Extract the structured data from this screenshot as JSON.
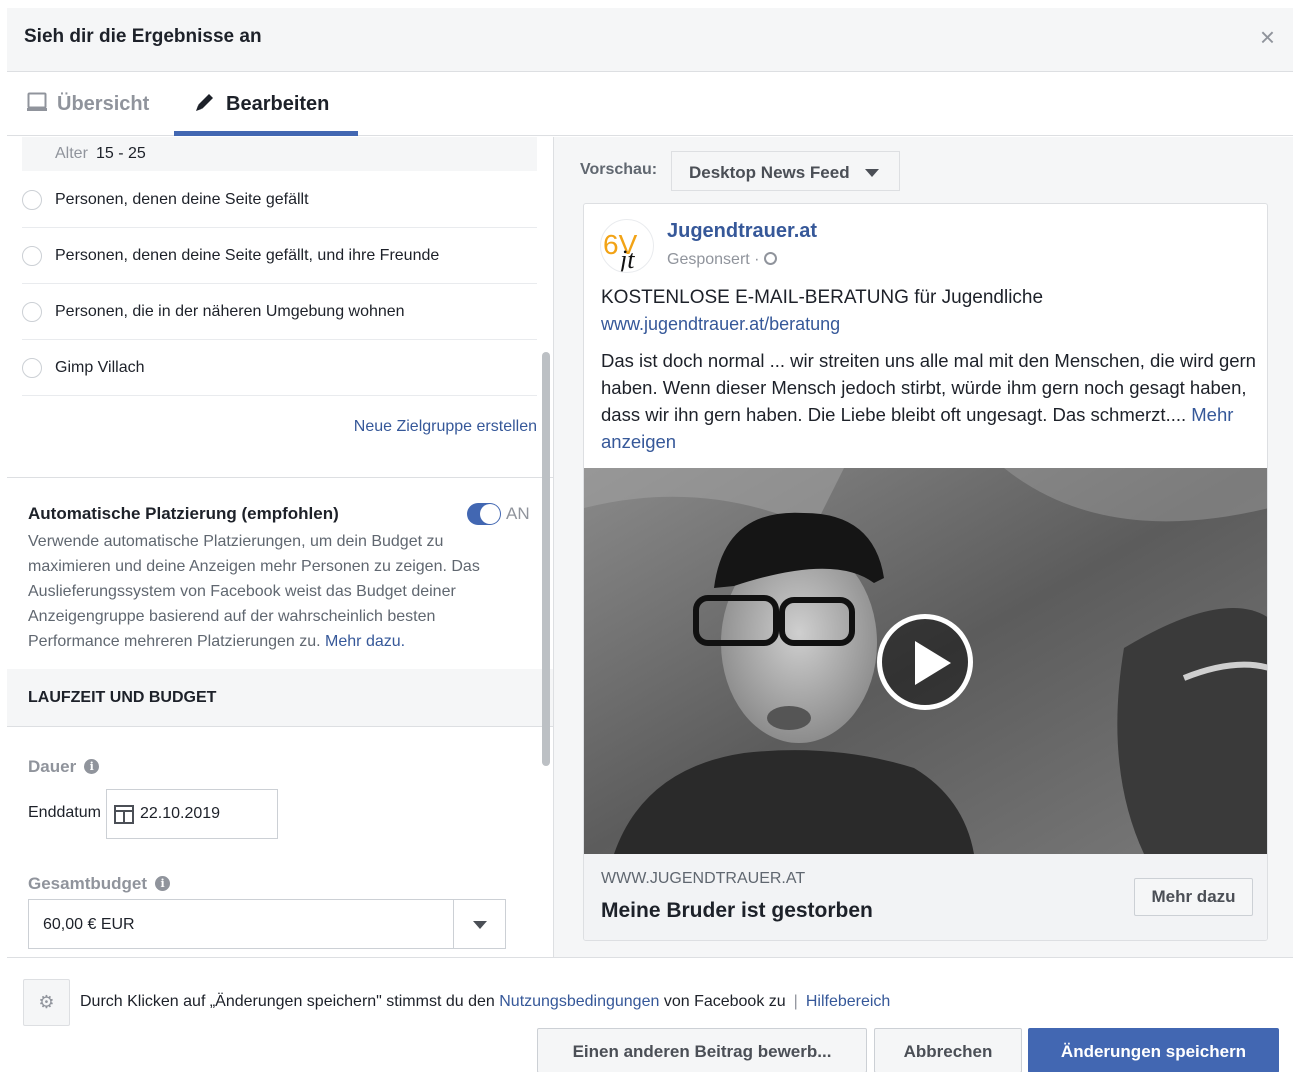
{
  "dialog": {
    "title": "Sieh dir die Ergebnisse an",
    "close": "×"
  },
  "tabs": [
    {
      "label": "Übersicht",
      "active": false
    },
    {
      "label": "Bearbeiten",
      "active": true
    }
  ],
  "audience": {
    "age_label": "Alter",
    "age_value": "15 - 25",
    "options": [
      "Personen, denen deine Seite gefällt",
      "Personen, denen deine Seite gefällt, und ihre Freunde",
      "Personen, die in der näheren Umgebung wohnen",
      "Gimp Villach"
    ],
    "new_audience_link": "Neue Zielgruppe erstellen"
  },
  "placement": {
    "title": "Automatische Platzierung (empfohlen)",
    "toggle_label": "AN",
    "description": "Verwende automatische Platzierungen, um dein Budget zu maximieren und deine Anzeigen mehr Personen zu zeigen. Das Auslieferungssystem von Facebook weist das Budget deiner Anzeigengruppe basierend auf der wahrscheinlich besten Performance mehreren Platzierungen zu. ",
    "learn_more": "Mehr dazu."
  },
  "budget_section": {
    "header": "LAUFZEIT UND BUDGET",
    "duration_label": "Dauer",
    "end_date_label": "Enddatum",
    "end_date_value": "22.10.2019",
    "total_budget_label": "Gesamtbudget",
    "total_budget_value": "60,00 € EUR",
    "info_glyph": "i"
  },
  "preview": {
    "label": "Vorschau:",
    "placement_select": "Desktop News Feed",
    "post": {
      "logo_text": "6Vjt",
      "page_name": "Jugendtrauer.at",
      "sponsored": "Gesponsert ·",
      "headline": "KOSTENLOSE E-MAIL-BERATUNG für Jugendliche",
      "url": "www.jugendtrauer.at/beratung",
      "body": "Das ist doch normal ... wir streiten uns alle mal mit den Menschen, die wird gern haben. Wenn dieser Mensch jedoch stirbt, würde ihm gern noch gesagt haben, dass wir ihn gern haben. Die Liebe bleibt oft ungesagt. Das schmerzt.... ",
      "see_more": "Mehr anzeigen",
      "link_domain": "WWW.JUGENDTRAUER.AT",
      "link_title": "Meine Bruder ist gestorben",
      "cta": "Mehr dazu"
    }
  },
  "footer": {
    "terms_prefix": "Durch Klicken auf „Änderungen speichern\" stimmst du den ",
    "terms_link": "Nutzungsbedingungen",
    "terms_suffix": " von Facebook zu",
    "separator": "|",
    "help_link": "Hilfebereich",
    "buttons": {
      "other_post": "Einen anderen Beitrag bewerb...",
      "cancel": "Abbrechen",
      "save": "Änderungen speichern"
    }
  },
  "colors": {
    "accent": "#4267b2",
    "link": "#365899",
    "muted": "#90949c"
  }
}
